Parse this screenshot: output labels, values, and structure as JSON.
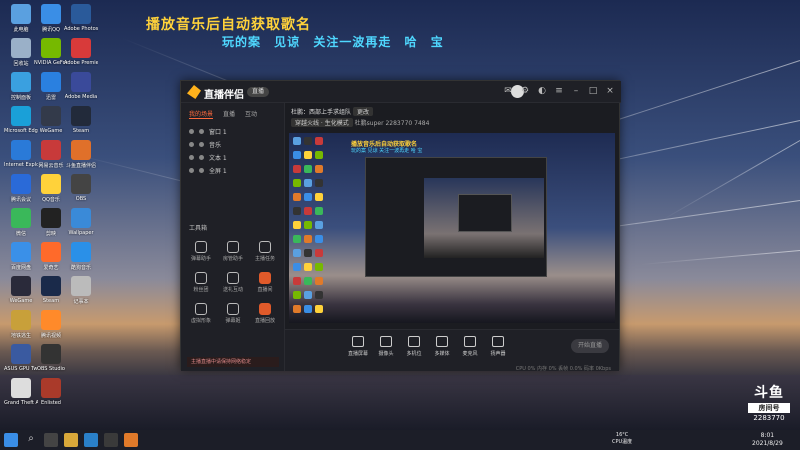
{
  "headline": {
    "line1": "播放音乐后自动获取歌名",
    "line2": "玩的案 见谅 关注一波再走 哈 宝"
  },
  "desktop_icons": [
    {
      "label": "此电脑",
      "color": "#5aa0e0",
      "col": 0,
      "row": 0
    },
    {
      "label": "腾讯QQ",
      "color": "#3a8ee6",
      "col": 1,
      "row": 0
    },
    {
      "label": "Adobe Photoshop",
      "color": "#2a5a9a",
      "col": 2,
      "row": 0
    },
    {
      "label": "回收站",
      "color": "#9ab0c8",
      "col": 0,
      "row": 1
    },
    {
      "label": "NVIDIA GeForce",
      "color": "#76b900",
      "col": 1,
      "row": 1
    },
    {
      "label": "Adobe Premiere",
      "color": "#d83a3a",
      "col": 2,
      "row": 1
    },
    {
      "label": "控制面板",
      "color": "#3aa0e0",
      "col": 0,
      "row": 2
    },
    {
      "label": "迅雷",
      "color": "#2a80e0",
      "col": 1,
      "row": 2
    },
    {
      "label": "Adobe Media",
      "color": "#3a4a9a",
      "col": 2,
      "row": 2
    },
    {
      "label": "Microsoft Edge",
      "color": "#1aa0d8",
      "col": 0,
      "row": 3
    },
    {
      "label": "WeGame",
      "color": "#333a4a",
      "col": 1,
      "row": 3
    },
    {
      "label": "Steam",
      "color": "#222a3a",
      "col": 2,
      "row": 3
    },
    {
      "label": "Internet Explorer",
      "color": "#2a7ad8",
      "col": 0,
      "row": 4
    },
    {
      "label": "网易云音乐",
      "color": "#c83a3a",
      "col": 1,
      "row": 4
    },
    {
      "label": "斗鱼直播伴侣",
      "color": "#e0702a",
      "col": 2,
      "row": 4
    },
    {
      "label": "腾讯会议",
      "color": "#2a6ad8",
      "col": 0,
      "row": 5
    },
    {
      "label": "QQ音乐",
      "color": "#ffd23a",
      "col": 1,
      "row": 5
    },
    {
      "label": "OBS",
      "color": "#444",
      "col": 2,
      "row": 5
    },
    {
      "label": "微信",
      "color": "#3ab85a",
      "col": 0,
      "row": 6
    },
    {
      "label": "剪映",
      "color": "#222",
      "col": 1,
      "row": 6
    },
    {
      "label": "Wallpaper",
      "color": "#3a8ad8",
      "col": 2,
      "row": 6
    },
    {
      "label": "百度网盘",
      "color": "#3a90e8",
      "col": 0,
      "row": 7
    },
    {
      "label": "爱奇艺",
      "color": "#ff6a2a",
      "col": 1,
      "row": 7
    },
    {
      "label": "酷狗音乐",
      "color": "#2a90e8",
      "col": 2,
      "row": 7
    },
    {
      "label": "WeGame",
      "color": "#2a2a3a",
      "col": 0,
      "row": 8
    },
    {
      "label": "Steam",
      "color": "#1a2a4a",
      "col": 1,
      "row": 8
    },
    {
      "label": "记事本",
      "color": "#bbb",
      "col": 2,
      "row": 8
    },
    {
      "label": "地铁逃生",
      "color": "#c8a03a",
      "col": 0,
      "row": 9
    },
    {
      "label": "腾讯视频",
      "color": "#ff8a2a",
      "col": 1,
      "row": 9
    },
    {
      "label": "ASUS GPU Tweak",
      "color": "#3a5aa0",
      "col": 0,
      "row": 10
    },
    {
      "label": "OBS Studio",
      "color": "#333",
      "col": 1,
      "row": 10
    },
    {
      "label": "Grand Theft Auto V",
      "color": "#ddd",
      "col": 0,
      "row": 11
    },
    {
      "label": "Enlisted",
      "color": "#aa3a2a",
      "col": 1,
      "row": 11
    }
  ],
  "app": {
    "brand": "直播伴侣",
    "live_badge": "直播",
    "left_tabs": [
      "我的场景",
      "直播",
      "互动"
    ],
    "sources": [
      "窗口 1",
      "音乐",
      "文本 1",
      "全屏 1"
    ],
    "tools_header": "工具箱",
    "tools": [
      {
        "label": "弹幕助手",
        "red": false
      },
      {
        "label": "房管助手",
        "red": false
      },
      {
        "label": "主播任务",
        "red": false
      },
      {
        "label": "粉丝团",
        "red": false
      },
      {
        "label": "送礼互动",
        "red": false
      },
      {
        "label": "直播间",
        "red": true
      },
      {
        "label": "虚拟形象",
        "red": false
      },
      {
        "label": "弹幕姬",
        "red": false
      },
      {
        "label": "直播回放",
        "red": true
      }
    ],
    "tip": "主播直播中请保持网络稳定",
    "info_title": "杜鹏：西部上手求组队",
    "info_tag": "更改",
    "info_category": "穿越火线 · 生化模式",
    "info_user": "杜鹏super",
    "info_room": "2283770",
    "info_views": "7484",
    "preview_text1": "播放音乐后自动获取歌名",
    "preview_text2": "玩的案 见谅 关注一波再走 哈 宝",
    "bottom_buttons": [
      "直播屏幕",
      "摄像头",
      "多机位",
      "多媒体",
      "麦克风",
      "扬声器"
    ],
    "start_button": "开始直播",
    "status": "CPU 0%   内存 0%   丢帧 0.0%   码率 0Kbps"
  },
  "overlay": {
    "logo": "斗鱼",
    "room_label": "房间号",
    "room_number": "2283770"
  },
  "taskbar": {
    "temp": "16°C",
    "temp_label": "CPU温度",
    "time": "8:01",
    "date": "2021/8/29"
  }
}
